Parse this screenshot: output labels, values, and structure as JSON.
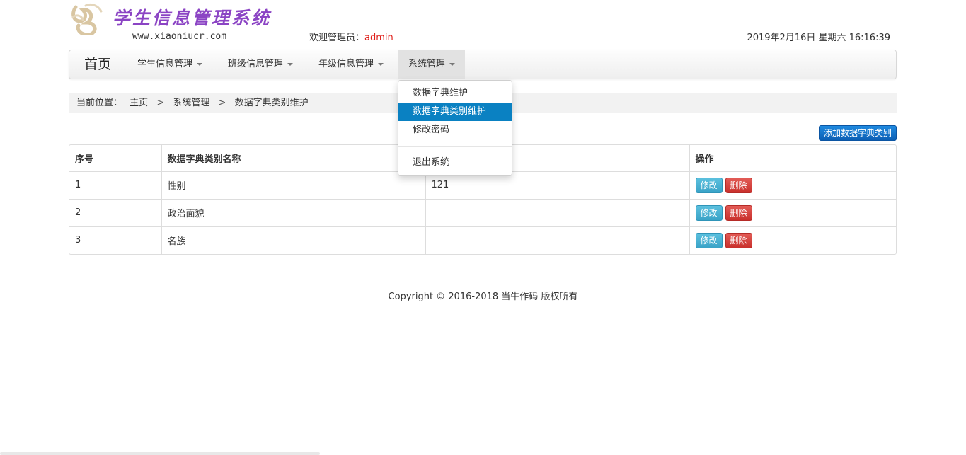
{
  "header": {
    "logo_title": "学生信息管理系统",
    "logo_url": "www.xiaoniucr.com",
    "welcome_prefix": "欢迎管理员：",
    "username": "admin",
    "datetime": "2019年2月16日 星期六 16:16:39"
  },
  "navbar": {
    "brand": "首页",
    "items": [
      {
        "label": "学生信息管理"
      },
      {
        "label": "班级信息管理"
      },
      {
        "label": "年级信息管理"
      },
      {
        "label": "系统管理"
      }
    ]
  },
  "dropdown": {
    "items": [
      {
        "label": "数据字典维护"
      },
      {
        "label": "数据字典类别维护"
      },
      {
        "label": "修改密码"
      },
      {
        "label": "退出系统"
      }
    ]
  },
  "breadcrumb": {
    "prefix": "当前位置：",
    "items": [
      "主页",
      "系统管理",
      "数据字典类别维护"
    ],
    "separator": ">"
  },
  "toolbar": {
    "add_label": "添加数据字典类别"
  },
  "table": {
    "headers": [
      "序号",
      "数据字典类别名称",
      "",
      "操作"
    ],
    "rows": [
      {
        "no": "1",
        "name": "性别",
        "desc": "121"
      },
      {
        "no": "2",
        "name": "政治面貌",
        "desc": ""
      },
      {
        "no": "3",
        "name": "名族",
        "desc": ""
      }
    ],
    "edit_label": "修改",
    "delete_label": "删除"
  },
  "footer": {
    "copyright": "Copyright © 2016-2018 当牛作码 版权所有"
  },
  "colors": {
    "accent": "#0a81c2",
    "username": "#e0201b",
    "logo": "#8b44c4"
  }
}
